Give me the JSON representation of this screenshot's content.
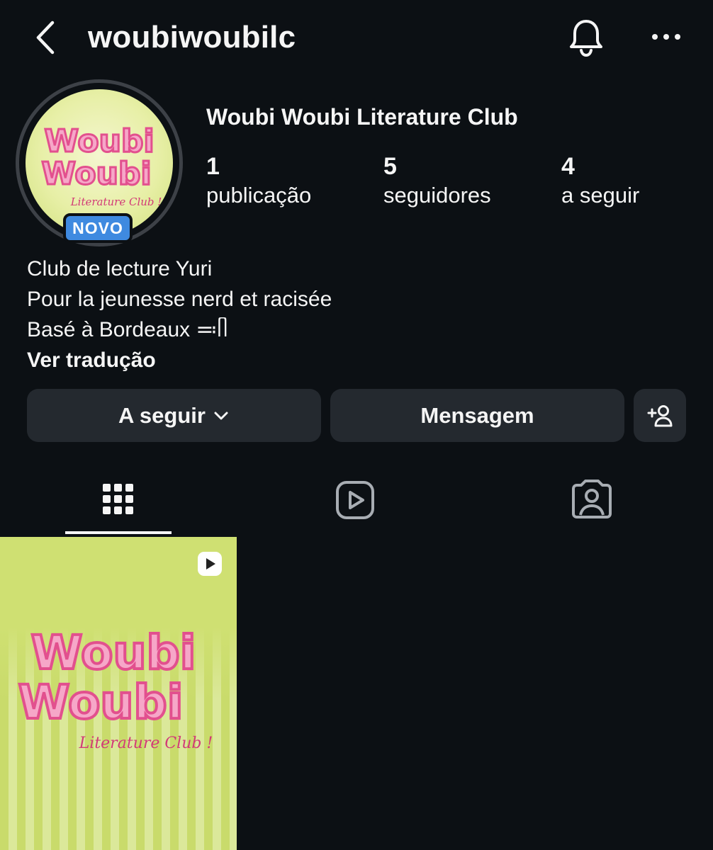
{
  "header": {
    "username": "woubiwoubilc",
    "back_icon": "chevron-left-icon",
    "notifications_icon": "bell-icon",
    "more_icon": "more-horizontal-icon"
  },
  "profile": {
    "display_name": "Woubi Woubi Literature Club",
    "badge": "NOVO",
    "avatar_logo": {
      "line1": "Woubi",
      "line2": "Woubi",
      "line3": "Literature Club !"
    },
    "stats": [
      {
        "value": "1",
        "label": "publicação"
      },
      {
        "value": "5",
        "label": "seguidores"
      },
      {
        "value": "4",
        "label": "a seguir"
      }
    ],
    "bio": [
      "Club de lecture Yuri",
      "Pour la jeunesse nerd et racisée",
      "Basé à Bordeaux ≕ᥥ"
    ],
    "translate_link": "Ver tradução"
  },
  "actions": {
    "following_label": "A seguir",
    "message_label": "Mensagem",
    "suggest_icon": "add-person-icon"
  },
  "tabs": [
    {
      "name": "grid",
      "icon": "grid-icon",
      "active": true
    },
    {
      "name": "reels",
      "icon": "reels-icon",
      "active": false
    },
    {
      "name": "tagged",
      "icon": "tagged-person-icon",
      "active": false
    }
  ],
  "posts": [
    {
      "type": "reel",
      "logo": {
        "line1": "Woubi",
        "line2": "Woubi",
        "line3": "Literature Club !"
      }
    }
  ],
  "colors": {
    "background": "#0c1014",
    "button": "#24292f",
    "badge": "#3f8ae0",
    "logo_pink": "#e2508e",
    "logo_light_pink": "#f6a7c8",
    "tile_green": "#cfe072"
  }
}
